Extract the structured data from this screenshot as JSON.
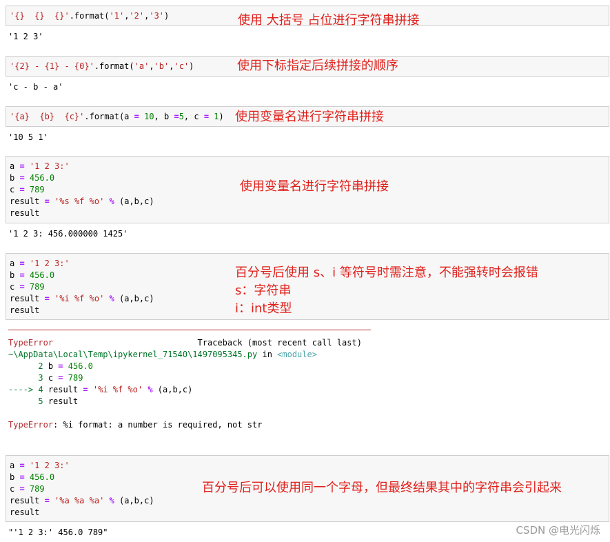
{
  "cells": [
    {
      "code": [
        "'{}  {}  {}'.format('1','2','3')"
      ],
      "note": [
        "使用 大括号 占位进行字符串拼接"
      ],
      "output": [
        "'1 2 3'"
      ]
    },
    {
      "code": [
        "'{2} - {1} - {0}'.format('a','b','c')"
      ],
      "note": [
        "使用下标指定后续拼接的顺序"
      ],
      "output": [
        "'c - b - a'"
      ]
    },
    {
      "code": [
        "'{a}  {b}  {c}'.format(a = 10, b =5, c = 1)"
      ],
      "note": [
        "使用变量名进行字符串拼接"
      ],
      "output": [
        "'10 5 1'"
      ]
    },
    {
      "code": [
        "a = '1 2 3:'",
        "b = 456.0",
        "c = 789",
        "result = '%s %f %o' % (a,b,c)",
        "result"
      ],
      "note": [
        "使用变量名进行字符串拼接"
      ],
      "output": [
        "'1 2 3: 456.000000 1425'"
      ]
    },
    {
      "code": [
        "a = '1 2 3:'",
        "b = 456.0",
        "c = 789",
        "result = '%i %f %o' % (a,b,c)",
        "result"
      ],
      "note": [
        "百分号后使用 s、i 等符号时需注意，不能强转时会报错",
        "s：字符串",
        "i：int类型"
      ],
      "output": []
    },
    {
      "code": [
        "a = '1 2 3:'",
        "b = 456.0",
        "c = 789",
        "result = '%a %a %a' % (a,b,c)",
        "result"
      ],
      "note": [
        "百分号后可以使用同一个字母，但最终结果其中的字符串会引起来"
      ],
      "output": [
        "\"'1 2 3:' 456.0 789\""
      ]
    }
  ],
  "traceback": {
    "error_name": "TypeError",
    "header_right": "Traceback (most recent call last)",
    "file_path": "~\\AppData\\Local\\Temp\\ipykernel_71540\\1497095345.py",
    "in_word": "in",
    "module": "<module>",
    "lines": [
      {
        "arrow": "      ",
        "num": "2",
        "text": "b = 456.0"
      },
      {
        "arrow": "      ",
        "num": "3",
        "text": "c = 789"
      },
      {
        "arrow": "----> ",
        "num": "4",
        "text": "result = '%i %f %o' % (a,b,c)"
      },
      {
        "arrow": "      ",
        "num": "5",
        "text": "result"
      }
    ],
    "message": ": %i format: a number is required, not str"
  },
  "watermark": "CSDN @电光闪烁"
}
